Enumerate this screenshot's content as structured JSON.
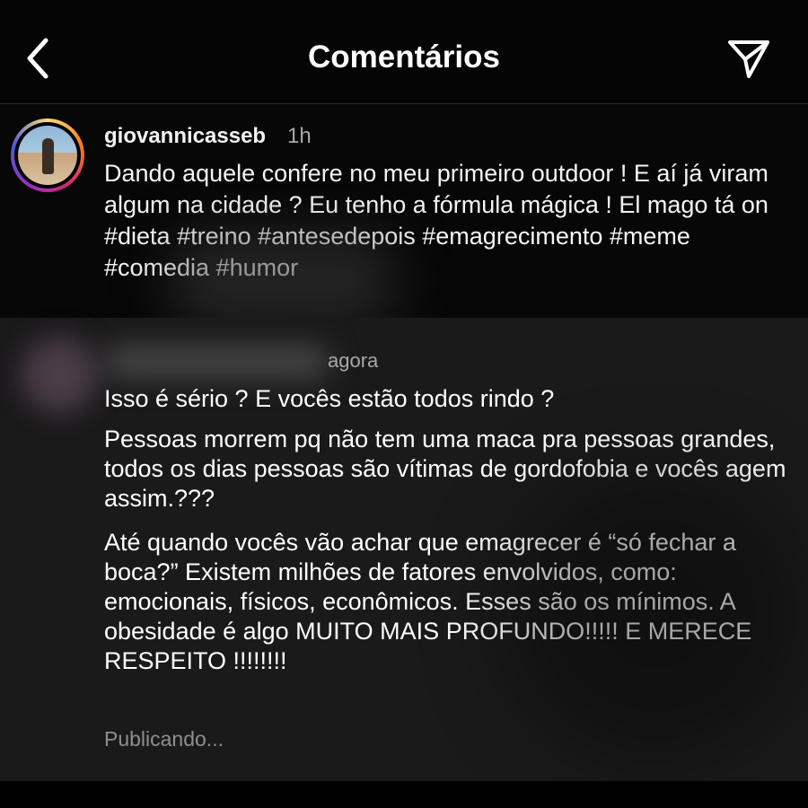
{
  "header": {
    "title": "Comentários",
    "back_icon": "chevron-left-icon",
    "send_icon": "paper-plane-icon"
  },
  "caption": {
    "username": "giovannicasseb",
    "time": "1h",
    "text": "Dando aquele confere no meu primeiro outdoor ! E aí já viram algum na cidade ? Eu tenho a fórmula mágica ! El mago tá on #dieta #treino #antesedepois #emagrecimento #meme #comedia #humor"
  },
  "comment": {
    "time": "agora",
    "line1": "Isso é sério ? E vocês estão todos rindo ?",
    "paragraph1": "Pessoas morrem pq não tem uma maca pra pessoas grandes, todos os dias pessoas são vítimas de gordofobia e vocês agem assim.???",
    "paragraph2": "Até quando vocês vão achar que emagrecer é “só fechar a boca?” Existem milhões de fatores envolvidos, como: emocionais, físicos, econômicos. Esses são os mínimos. A obesidade é algo MUITO MAIS PROFUNDO!!!!! E MERECE RESPEITO !!!!!!!!",
    "status": "Publicando..."
  },
  "colors": {
    "background": "#000000",
    "comment_panel": "#1b1a1b",
    "secondary_text": "#a8a8a8"
  }
}
